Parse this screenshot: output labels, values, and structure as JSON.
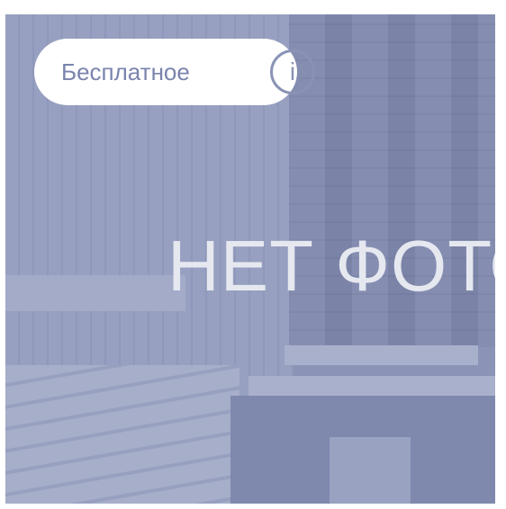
{
  "placeholder_text": "НЕТ ФОТО",
  "badge": {
    "label": "Бесплатное",
    "icon": "info-icon",
    "icon_glyph": "i"
  },
  "colors": {
    "overlay": "#8b93b6",
    "badge_text": "#7a84ad"
  }
}
